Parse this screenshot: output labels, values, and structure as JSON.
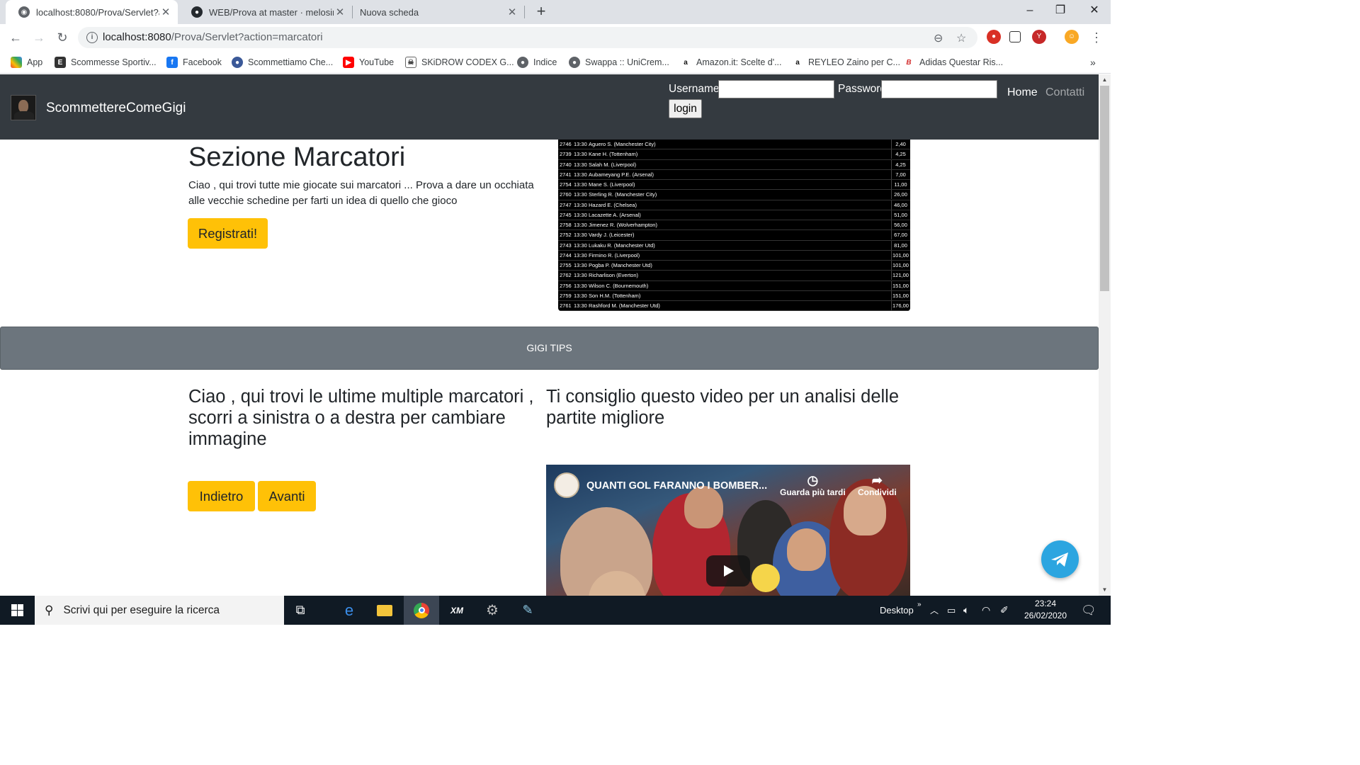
{
  "tabs": [
    {
      "title": "localhost:8080/Prova/Servlet?action=marcatori",
      "active": true
    },
    {
      "title": "WEB/Prova at master · melosinghi",
      "active": false
    },
    {
      "title": "Nuova scheda",
      "active": false
    }
  ],
  "address_bar": {
    "host": "localhost:8080",
    "path": "/Prova/Servlet?action=marcatori"
  },
  "bookmarks": [
    {
      "label": "App",
      "icon": "apps-grid-icon"
    },
    {
      "label": "Scommesse Sportiv...",
      "icon": "betting-site-icon"
    },
    {
      "label": "Facebook",
      "icon": "facebook-icon"
    },
    {
      "label": "Scommettiamo Che...",
      "icon": "globe-icon"
    },
    {
      "label": "YouTube",
      "icon": "youtube-icon"
    },
    {
      "label": "SKiDROW CODEX G...",
      "icon": "skidrow-icon"
    },
    {
      "label": "Indice",
      "icon": "globe-icon"
    },
    {
      "label": "Swappa :: UniCrem...",
      "icon": "globe-icon"
    },
    {
      "label": "Amazon.it: Scelte d'...",
      "icon": "amazon-icon"
    },
    {
      "label": "REYLEO Zaino per C...",
      "icon": "amazon-icon"
    },
    {
      "label": "Adidas Questar Ris...",
      "icon": "adidas-icon"
    }
  ],
  "navbar": {
    "brand": "ScommettereComeGigi",
    "username_label": "Username",
    "password_label": "Password",
    "login_label": "login",
    "links": [
      "Home",
      "Contatti"
    ]
  },
  "hero": {
    "title": "Sezione Marcatori",
    "text": "Ciao , qui trovi tutte mie giocate sui marcatori ... Prova a dare un occhiata alle vecchie schedine per farti un idea di quello che gioco",
    "cta": "Registrati!"
  },
  "scorers_table": [
    {
      "code": "2746",
      "time": "13:30",
      "player": "Aguero S. (Manchester City)",
      "odds": "2,40"
    },
    {
      "code": "2739",
      "time": "13:30",
      "player": "Kane H. (Tottenham)",
      "odds": "4,25"
    },
    {
      "code": "2740",
      "time": "13:30",
      "player": "Salah M. (Liverpool)",
      "odds": "4,25"
    },
    {
      "code": "2741",
      "time": "13:30",
      "player": "Aubameyang P.E. (Arsenal)",
      "odds": "7,00"
    },
    {
      "code": "2754",
      "time": "13:30",
      "player": "Mane S. (Liverpool)",
      "odds": "11,00"
    },
    {
      "code": "2760",
      "time": "13:30",
      "player": "Sterling R. (Manchester City)",
      "odds": "26,00"
    },
    {
      "code": "2747",
      "time": "13:30",
      "player": "Hazard E. (Chelsea)",
      "odds": "46,00"
    },
    {
      "code": "2745",
      "time": "13:30",
      "player": "Lacazette A. (Arsenal)",
      "odds": "51,00"
    },
    {
      "code": "2758",
      "time": "13:30",
      "player": "Jimenez R. (Wolverhampton)",
      "odds": "56,00"
    },
    {
      "code": "2752",
      "time": "13:30",
      "player": "Vardy J. (Leicester)",
      "odds": "67,00"
    },
    {
      "code": "2743",
      "time": "13:30",
      "player": "Lukaku R. (Manchester Utd)",
      "odds": "81,00"
    },
    {
      "code": "2744",
      "time": "13:30",
      "player": "Firmino R. (Liverpool)",
      "odds": "101,00"
    },
    {
      "code": "2755",
      "time": "13:30",
      "player": "Pogba P. (Manchester Utd)",
      "odds": "101,00"
    },
    {
      "code": "2762",
      "time": "13:30",
      "player": "Richarlison (Everton)",
      "odds": "121,00"
    },
    {
      "code": "2756",
      "time": "13:30",
      "player": "Wilson C. (Bournemouth)",
      "odds": "151,00"
    },
    {
      "code": "2759",
      "time": "13:30",
      "player": "Son H.M. (Tottenham)",
      "odds": "151,00"
    },
    {
      "code": "2761",
      "time": "13:30",
      "player": "Rashford M. (Manchester Utd)",
      "odds": "176,00"
    }
  ],
  "banner": {
    "text": "GIGI TIPS"
  },
  "multiples": {
    "title": "Ciao , qui trovi le ultime multiple marcatori , scorri a sinistra o a destra per cambiare immagine",
    "prev": "Indietro",
    "next": "Avanti"
  },
  "video_section": {
    "title": "Ti consiglio questo video per un analisi delle partite migliore",
    "video_title": "QUANTI GOL FARANNO I BOMBER...",
    "watch_later": "Guarda più tardi",
    "share": "Condividi"
  },
  "taskbar": {
    "search_placeholder": "Scrivi qui per eseguire la ricerca",
    "desktop_label": "Desktop",
    "time": "23:24",
    "date": "26/02/2020"
  },
  "colors": {
    "navbar": "#343a40",
    "accent": "#ffc107",
    "banner": "#6c757d",
    "telegram": "#2ca5e0"
  }
}
